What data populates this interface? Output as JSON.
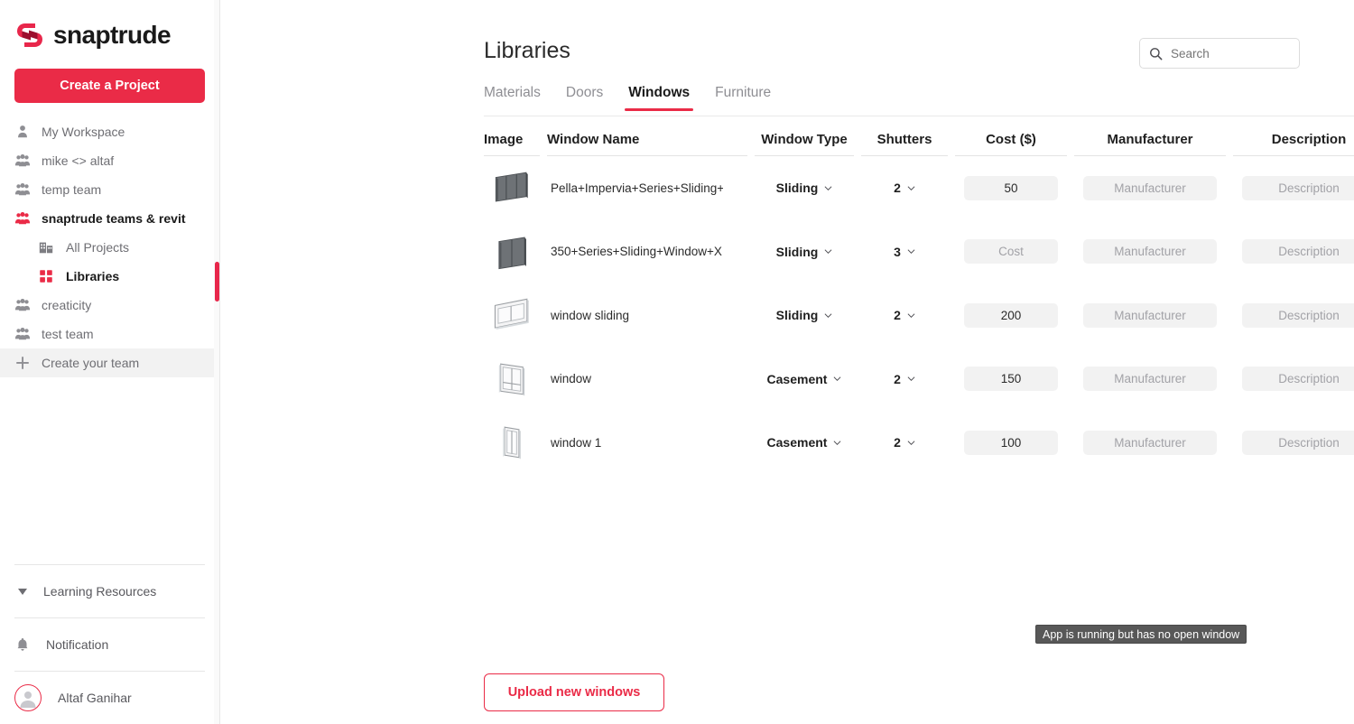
{
  "brand": {
    "name": "snaptrude",
    "accent": "#ea2b47",
    "logo_icon": "snaptrude-logo-icon"
  },
  "sidebar": {
    "create_project_label": "Create a Project",
    "items": [
      {
        "label": "My Workspace",
        "icon": "person-icon",
        "level": 0,
        "active": false
      },
      {
        "label": "mike <> altaf",
        "icon": "people-group-icon",
        "level": 0,
        "active": false
      },
      {
        "label": "temp team",
        "icon": "people-group-icon",
        "level": 0,
        "active": false
      },
      {
        "label": "snaptrude teams & revit",
        "icon": "people-group-icon",
        "level": 0,
        "active": true
      },
      {
        "label": "All Projects",
        "icon": "buildings-icon",
        "level": 1,
        "active": false
      },
      {
        "label": "Libraries",
        "icon": "grid-squares-icon",
        "level": 1,
        "active": true
      },
      {
        "label": "creaticity",
        "icon": "people-group-icon",
        "level": 0,
        "active": false
      },
      {
        "label": "test team",
        "icon": "people-group-icon",
        "level": 0,
        "active": false
      },
      {
        "label": "Create your team",
        "icon": "plus-icon",
        "level": 0,
        "active": false
      }
    ],
    "footer": {
      "learning_resources": "Learning Resources",
      "notification": "Notification",
      "user_name": "Altaf Ganihar"
    }
  },
  "header": {
    "title": "Libraries",
    "search": {
      "placeholder": "Search",
      "value": "",
      "icon": "search-icon"
    }
  },
  "tabs": [
    {
      "label": "Materials",
      "active": false
    },
    {
      "label": "Doors",
      "active": false
    },
    {
      "label": "Windows",
      "active": true
    },
    {
      "label": "Furniture",
      "active": false
    }
  ],
  "table": {
    "columns": [
      "Image",
      "Window Name",
      "Window Type",
      "Shutters",
      "Cost ($)",
      "Manufacturer",
      "Description"
    ],
    "placeholders": {
      "cost": "Cost",
      "manufacturer": "Manufacturer",
      "description": "Description"
    },
    "rows": [
      {
        "thumb": "window-thumbnail-dark-sliding-3panel",
        "name": "Pella+Impervia+Series+Sliding+V",
        "type": "Sliding",
        "shutters": "2",
        "cost": "50",
        "manufacturer": "",
        "description": ""
      },
      {
        "thumb": "window-thumbnail-dark-sliding-2panel",
        "name": "350+Series+Sliding+Window+X",
        "type": "Sliding",
        "shutters": "3",
        "cost": "",
        "manufacturer": "",
        "description": ""
      },
      {
        "thumb": "window-thumbnail-light-sliding-wide",
        "name": "window sliding",
        "type": "Sliding",
        "shutters": "2",
        "cost": "200",
        "manufacturer": "",
        "description": ""
      },
      {
        "thumb": "window-thumbnail-light-casement-grid",
        "name": "window",
        "type": "Casement",
        "shutters": "2",
        "cost": "150",
        "manufacturer": "",
        "description": ""
      },
      {
        "thumb": "window-thumbnail-light-casement-tall",
        "name": "window 1",
        "type": "Casement",
        "shutters": "2",
        "cost": "100",
        "manufacturer": "",
        "description": ""
      }
    ]
  },
  "upload_button_label": "Upload new windows",
  "tooltip": {
    "text": "App is running but has no open window"
  }
}
